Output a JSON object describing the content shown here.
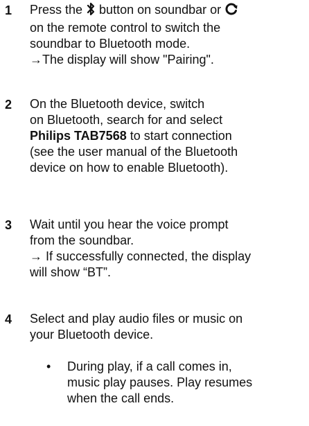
{
  "steps": [
    {
      "number": "1",
      "lines": [
        {
          "pre": "Press the ",
          "icon": "bluetooth-icon",
          "post": " button on soundbar or "
        },
        {
          "text": "on the remote control to switch the"
        },
        {
          "text": "soundbar to Bluetooth mode."
        },
        {
          "text": "→The display will show \"Pairing\"."
        }
      ],
      "source_icon": "source-icon"
    },
    {
      "number": "2",
      "lines": [
        {
          "text": "On the Bluetooth device, switch"
        },
        {
          "text": "on Bluetooth, search for and select"
        },
        {
          "bold": "Philips TAB7568",
          "post": " to start connection"
        },
        {
          "text": "(see the user manual of the Bluetooth"
        },
        {
          "text": "device on how to enable Bluetooth)."
        }
      ]
    },
    {
      "number": "3",
      "lines": [
        {
          "text": "Wait until you hear the voice prompt"
        },
        {
          "text": "from the soundbar."
        },
        {
          "text": "→ If successfully connected, the display"
        },
        {
          "text": "will show “BT”."
        }
      ]
    },
    {
      "number": "4",
      "lines": [
        {
          "text": "Select and play audio files or music on"
        },
        {
          "text": "your Bluetooth device."
        }
      ],
      "bullets": [
        {
          "symbol": "•",
          "lines": [
            {
              "text": "During play, if a call comes in,"
            },
            {
              "text": "music play pauses. Play resumes"
            },
            {
              "text": "when the call ends."
            }
          ]
        }
      ]
    }
  ]
}
